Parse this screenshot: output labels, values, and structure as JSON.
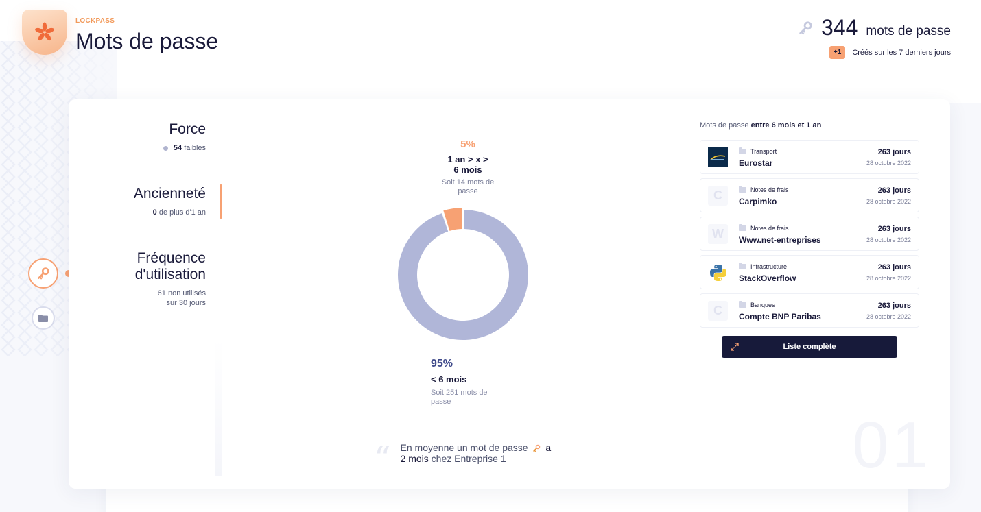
{
  "header": {
    "brand": "LOCKPASS",
    "title": "Mots de passe",
    "count": "344",
    "count_label": "mots de passe",
    "badge": "+1",
    "created_text": "Créés sur les 7 derniers jours"
  },
  "menu": {
    "force": {
      "title": "Force",
      "count": "54",
      "label": "faibles"
    },
    "anciennete": {
      "title": "Ancienneté",
      "count": "0",
      "label": "de plus d'1 an"
    },
    "frequence": {
      "title_line1": "Fréquence",
      "title_line2": "d'utilisation",
      "line1": "61 non utilisés",
      "line2": "sur 30 jours"
    }
  },
  "chart_data": {
    "type": "pie",
    "donut": true,
    "slices": [
      {
        "pct_label": "5%",
        "name_line1": "1 an > x >",
        "name_line2": "6 mois",
        "sub_line1": "Soit 14 mots de",
        "sub_line2": "passe",
        "value": 5,
        "color": "#f7a173"
      },
      {
        "pct_label": "95%",
        "name": "< 6 mois",
        "sub_line1": "Soit 251 mots de",
        "sub_line2": "passe",
        "value": 95,
        "color": "#b0b6d8"
      }
    ]
  },
  "quote": {
    "part1": "En moyenne un mot de passe",
    "part2": "a",
    "value": "2 mois",
    "part3": "chez Entreprise 1"
  },
  "list": {
    "head_prefix": "Mots de passe",
    "head_bold": "entre 6 mois et 1 an",
    "rows": [
      {
        "category": "Transport",
        "name": "Eurostar",
        "days": "263 jours",
        "date": "28 octobre 2022",
        "icon": "eurostar-logo"
      },
      {
        "category": "Notes de frais",
        "name": "Carpimko",
        "days": "263 jours",
        "date": "28 octobre 2022",
        "icon": "C"
      },
      {
        "category": "Notes de frais",
        "name": "Www.net-entreprises",
        "days": "263 jours",
        "date": "28 octobre 2022",
        "icon": "W"
      },
      {
        "category": "Infrastructure",
        "name": "StackOverflow",
        "days": "263 jours",
        "date": "28 octobre 2022",
        "icon": "python-logo"
      },
      {
        "category": "Banques",
        "name": "Compte BNP Paribas",
        "days": "263 jours",
        "date": "28 octobre 2022",
        "icon": "C"
      }
    ],
    "button": "Liste complète"
  },
  "background_number": "01",
  "colors": {
    "accent": "#f7a173",
    "navy": "#171a3a",
    "lavender": "#b0b6d8"
  }
}
